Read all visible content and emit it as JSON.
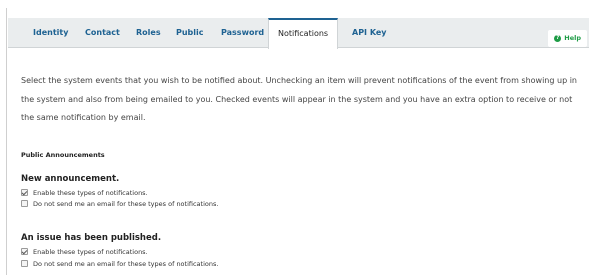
{
  "tabs": [
    {
      "label": "Identity"
    },
    {
      "label": "Contact"
    },
    {
      "label": "Roles"
    },
    {
      "label": "Public"
    },
    {
      "label": "Password"
    },
    {
      "label": "Notifications",
      "active": true
    },
    {
      "label": "API Key"
    }
  ],
  "help": {
    "label": "Help",
    "icon": "help-circle-icon"
  },
  "intro": "Select the system events that you wish to be notified about. Unchecking an item will prevent notifications of the event from showing up in the system and also from being emailed to you. Checked events will appear in the system and you have an extra option to receive or not the same notification by email.",
  "section": {
    "title": "Public Announcements"
  },
  "groups": [
    {
      "title": "New announcement.",
      "options": [
        {
          "label": "Enable these types of notifications.",
          "checked": true
        },
        {
          "label": "Do not send me an email for these types of notifications.",
          "checked": false
        }
      ]
    },
    {
      "title": "An issue has been published.",
      "options": [
        {
          "label": "Enable these types of notifications.",
          "checked": true
        },
        {
          "label": "Do not send me an email for these types of notifications.",
          "checked": false
        }
      ]
    }
  ],
  "colors": {
    "link": "#1e6292",
    "help": "#1e9c46",
    "tabbar": "#eaedee"
  }
}
